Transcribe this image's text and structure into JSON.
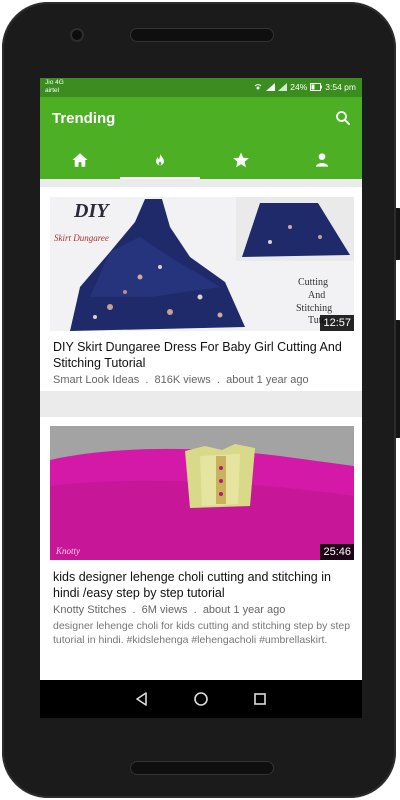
{
  "status": {
    "carrier_top": "Jio 4G",
    "carrier_bottom": "airtel",
    "battery": "24%",
    "time": "3:54 pm"
  },
  "appbar": {
    "title": "Trending",
    "tabs": [
      {
        "icon": "home-icon",
        "selected": false
      },
      {
        "icon": "fire-icon",
        "selected": true
      },
      {
        "icon": "star-icon",
        "selected": false
      },
      {
        "icon": "person-icon",
        "selected": false
      }
    ]
  },
  "videos": [
    {
      "title": "DIY Skirt Dungaree Dress For Baby Girl Cutting And Stitching Tutorial",
      "channel": "Smart Look Ideas",
      "views": "816K views",
      "age": "about 1 year ago",
      "duration": "12:57",
      "thumb_text_1": "DIY",
      "thumb_text_2": "Skirt Dungaree",
      "thumb_text_3": "Cutting And Stitching Tutor"
    },
    {
      "title": "kids designer lehenge choli cutting and stitching in hindi /easy step by step tutorial",
      "channel": "Knotty Stitches",
      "views": "6M views",
      "age": "about 1 year ago",
      "duration": "25:46",
      "description": "designer lehenge choli for kids cutting and stitching step by step tutorial in hindi. #kidslehenga #lehengacholi #umbrellaskirt.",
      "thumb_text_1": "Knotty"
    }
  ],
  "colors": {
    "appbar": "#4caf24",
    "statusbar": "#3a8d1e"
  }
}
